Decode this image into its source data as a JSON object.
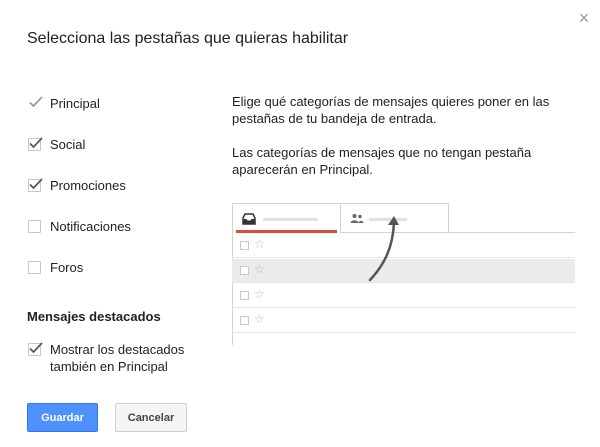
{
  "dialog": {
    "title": "Selecciona las pestañas que quieras habilitar",
    "close_glyph": "×"
  },
  "tabs_options": [
    {
      "label": "Principal",
      "checked": true,
      "disabled": true
    },
    {
      "label": "Social",
      "checked": true,
      "disabled": false
    },
    {
      "label": "Promociones",
      "checked": true,
      "disabled": false
    },
    {
      "label": "Notificaciones",
      "checked": false,
      "disabled": false
    },
    {
      "label": "Foros",
      "checked": false,
      "disabled": false
    }
  ],
  "starred": {
    "title": "Mensajes destacados",
    "option_line1": "Mostrar los destacados",
    "option_line2": "también en Principal",
    "checked": true
  },
  "description": {
    "p1": "Elige qué categorías de mensajes quieres poner en las pestañas de tu bandeja de entrada.",
    "p2": "Las categorías de mensajes que no tengan pestaña aparecerán en Principal."
  },
  "preview": {
    "tab_icons": [
      "inbox-icon",
      "people-icon"
    ],
    "accent_color": "#dd4b39",
    "rows": 4,
    "star_glyph": "☆"
  },
  "buttons": {
    "save": "Guardar",
    "cancel": "Cancelar"
  },
  "colors": {
    "primary": "#4d90fe",
    "check": "#555555"
  }
}
